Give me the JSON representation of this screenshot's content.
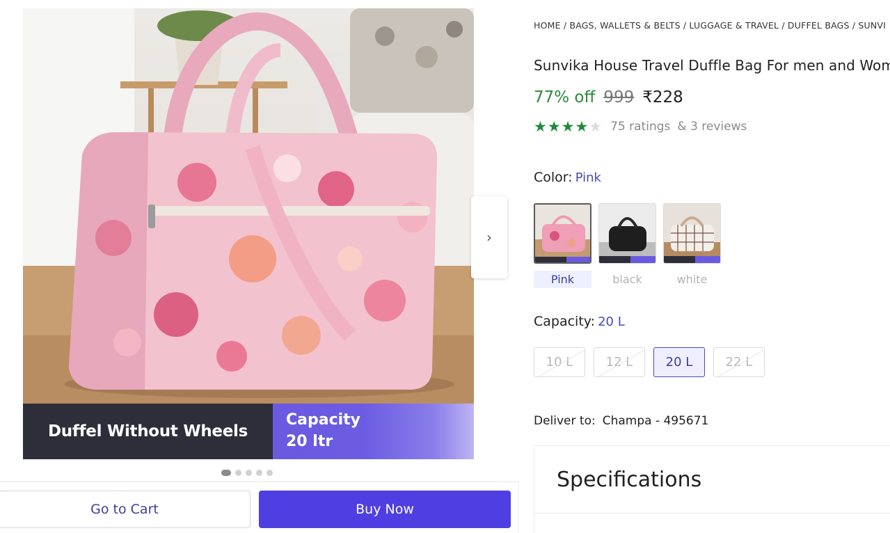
{
  "gallery": {
    "banner_left": "Duffel Without Wheels",
    "banner_right_line1": "Capacity",
    "banner_right_line2": "20 ltr",
    "next_icon": "chevron-right-icon",
    "dots_count": 5,
    "active_dot": 1
  },
  "actions": {
    "cart_label": "Go to Cart",
    "buy_label": "Buy Now"
  },
  "breadcrumb": "HOME / BAGS, WALLETS & BELTS / LUGGAGE & TRAVEL / DUFFEL BAGS / SUNVI",
  "product": {
    "title": "Sunvika House Travel Duffle Bag For men and Wom",
    "discount": "77% off",
    "mrp": "999",
    "price": "₹228",
    "rating_value": 4,
    "rating_max": 5,
    "ratings_text": "75 ratings",
    "reviews_text": "& 3 reviews"
  },
  "color": {
    "label": "Color:",
    "selected": "Pink",
    "options": [
      "Pink",
      "black",
      "white"
    ]
  },
  "capacity": {
    "label": "Capacity:",
    "selected": "20 L",
    "options": [
      "10 L",
      "12 L",
      "20 L",
      "22 L"
    ]
  },
  "delivery": {
    "label": "Deliver to:",
    "location": "Champa - 495671"
  },
  "specs": {
    "title": "Specifications"
  },
  "colors": {
    "primary": "#4f3fe2",
    "discount": "#2d8a3a",
    "star": "#1f8a3a",
    "selected_text": "#4a4ab0"
  }
}
